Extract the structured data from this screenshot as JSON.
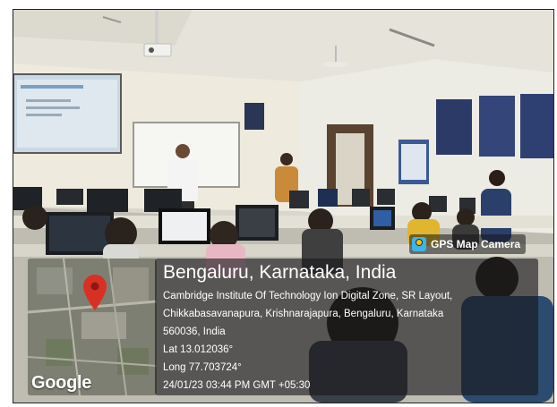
{
  "stamp": {
    "app_name": "GPS Map Camera",
    "location_title": "Bengaluru, Karnataka, India",
    "address_line1": "Cambridge Institute Of Technology Ion Digital Zone, SR Layout,",
    "address_line2": "Chikkabasavanapura, Krishnarajapura, Bengaluru, Karnataka",
    "address_line3": "560036, India",
    "latitude": "Lat 13.012036°",
    "longitude": "Long 77.703724°",
    "datetime": "24/01/23 03:44 PM GMT +05:30"
  },
  "map": {
    "provider": "Google",
    "pin_color": "#d93025",
    "icon": "map-pin-icon"
  },
  "camera_icon": "camera-app-icon"
}
